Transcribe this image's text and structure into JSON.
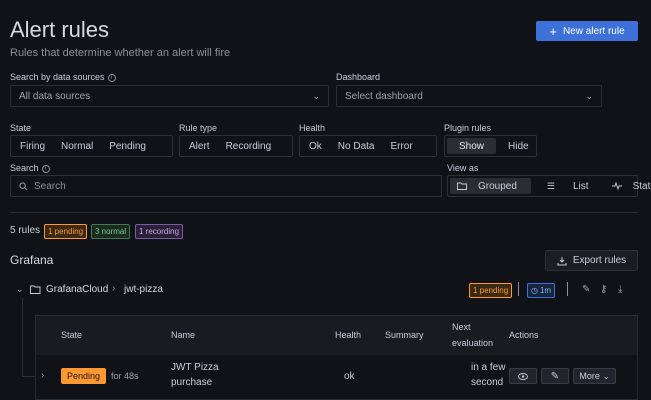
{
  "page": {
    "title": "Alert rules",
    "subtitle": "Rules that determine whether an alert will fire",
    "new_rule": "New alert rule"
  },
  "filters": {
    "datasource_label": "Search by data sources",
    "datasource_value": "All data sources",
    "dashboard_label": "Dashboard",
    "dashboard_value": "Select dashboard",
    "state_label": "State",
    "state_options": [
      "Firing",
      "Normal",
      "Pending"
    ],
    "ruletype_label": "Rule type",
    "ruletype_options": [
      "Alert",
      "Recording"
    ],
    "health_label": "Health",
    "health_options": [
      "Ok",
      "No Data",
      "Error"
    ],
    "plugin_label": "Plugin rules",
    "plugin_options": [
      "Show",
      "Hide"
    ],
    "search_label": "Search",
    "search_placeholder": "Search",
    "view_label": "View as",
    "view_options": [
      "Grouped",
      "List",
      "State"
    ]
  },
  "summary": {
    "rules": "5 rules",
    "pending": "1 pending",
    "normal": "3 normal",
    "recording": "1 recording"
  },
  "section": {
    "title": "Grafana",
    "export": "Export rules"
  },
  "group": {
    "folder": "GrafanaCloud",
    "name": "jwt-pizza",
    "pending": "1 pending",
    "interval": "1m"
  },
  "table": {
    "headers": {
      "state": "State",
      "name": "Name",
      "health": "Health",
      "summary": "Summary",
      "next_line1": "Next",
      "next_line2": "evaluation",
      "actions": "Actions"
    },
    "row": {
      "state": "Pending",
      "duration": "for 48s",
      "name_line1": "JWT Pizza",
      "name_line2": "purchase",
      "health": "ok",
      "next_line1": "in a few",
      "next_line2": "second",
      "more": "More"
    }
  }
}
